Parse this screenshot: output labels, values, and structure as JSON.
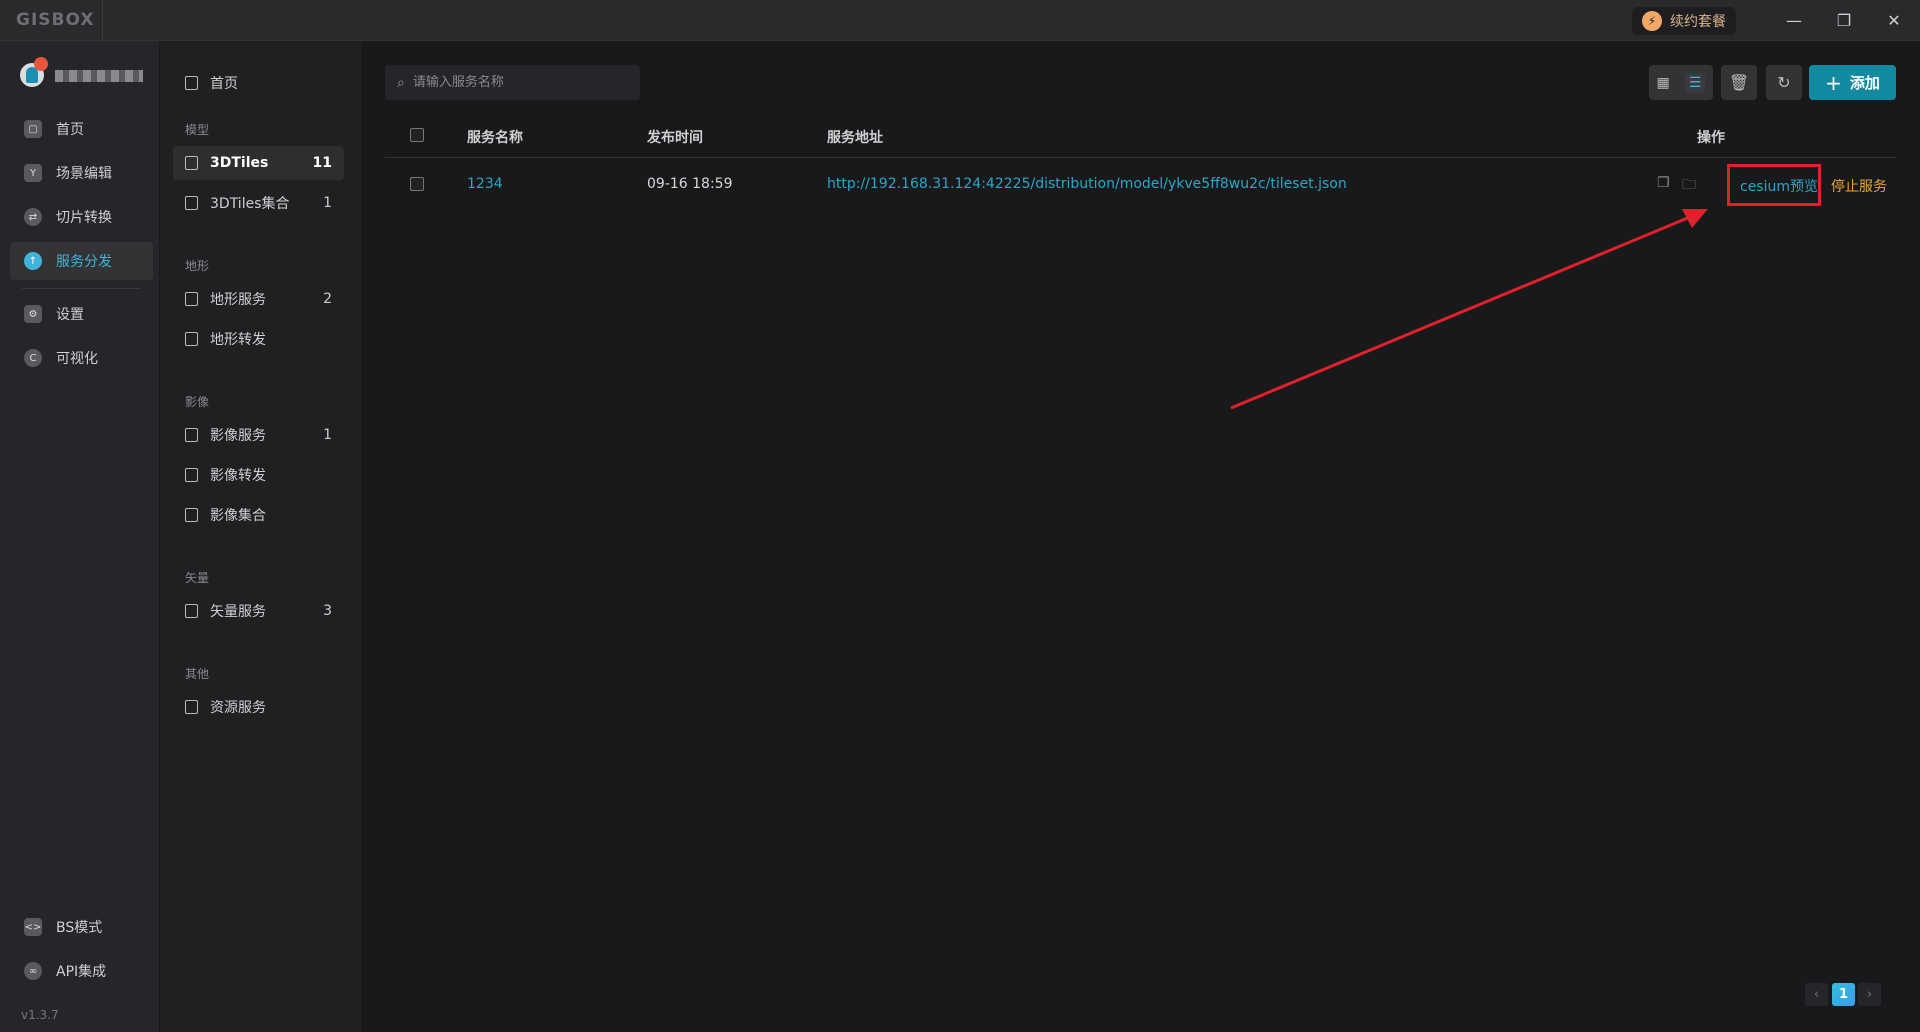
{
  "app": {
    "logo": "GISBOX",
    "renew_label": "续约套餐",
    "version": "v1.3.7"
  },
  "colors": {
    "accent": "#148aa0",
    "link": "#2aa7c9",
    "stop": "#e8a530",
    "annotation": "#e0202a"
  },
  "nav_primary": [
    {
      "label": "首页",
      "icon": "home-icon"
    },
    {
      "label": "场景编辑",
      "icon": "cube-icon"
    },
    {
      "label": "切片转换",
      "icon": "swap-icon"
    },
    {
      "label": "服务分发",
      "icon": "cloud-upload-icon",
      "active": true
    },
    {
      "label": "设置",
      "icon": "gear-icon"
    },
    {
      "label": "可视化",
      "icon": "visual-icon"
    }
  ],
  "nav_bottom": [
    {
      "label": "BS模式",
      "icon": "code-icon"
    },
    {
      "label": "API集成",
      "icon": "link-icon"
    }
  ],
  "nav_secondary": {
    "home": "首页",
    "groups": [
      {
        "title": "模型",
        "items": [
          {
            "label": "3DTiles",
            "count": "11",
            "active": true
          },
          {
            "label": "3DTiles集合",
            "count": "1"
          }
        ]
      },
      {
        "title": "地形",
        "items": [
          {
            "label": "地形服务",
            "count": "2"
          },
          {
            "label": "地形转发",
            "count": ""
          }
        ]
      },
      {
        "title": "影像",
        "items": [
          {
            "label": "影像服务",
            "count": "1"
          },
          {
            "label": "影像转发",
            "count": ""
          },
          {
            "label": "影像集合",
            "count": ""
          }
        ]
      },
      {
        "title": "矢量",
        "items": [
          {
            "label": "矢量服务",
            "count": "3"
          }
        ]
      },
      {
        "title": "其他",
        "items": [
          {
            "label": "资源服务",
            "count": ""
          }
        ]
      }
    ]
  },
  "toolbar": {
    "search_placeholder": "请输入服务名称",
    "add_label": "添加"
  },
  "table": {
    "headers": {
      "name": "服务名称",
      "time": "发布时间",
      "url": "服务地址",
      "actions": "操作"
    },
    "rows": [
      {
        "name": "1234",
        "time": "09-16 18:59",
        "url": "http://192.168.31.124:42225/distribution/model/ykve5ff8wu2c/tileset.json",
        "preview": "cesium预览",
        "stop": "停止服务"
      }
    ]
  },
  "pagination": {
    "current": "1"
  }
}
